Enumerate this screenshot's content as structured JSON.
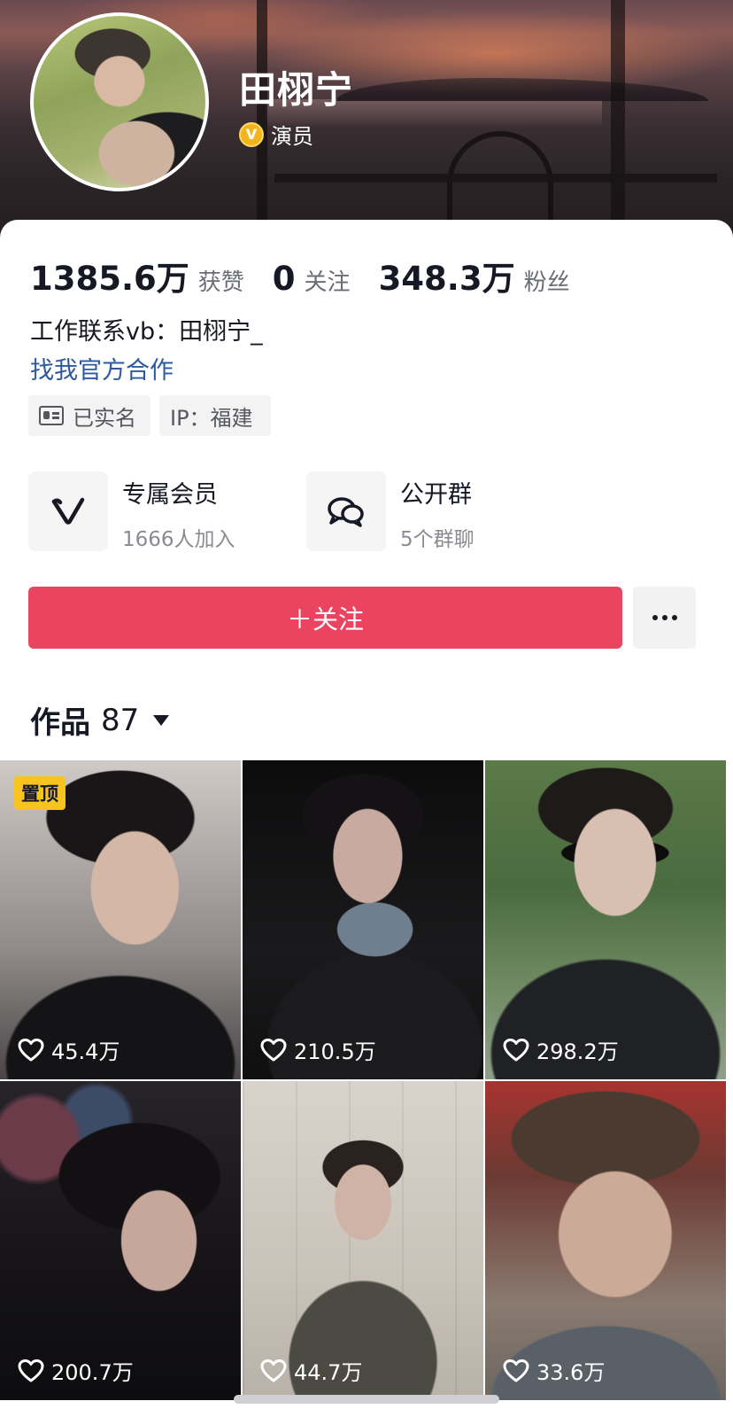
{
  "profile": {
    "name": "田栩宁",
    "verify_badge": "V",
    "verify_label": "演员",
    "stats": [
      {
        "num": "1385.6万",
        "label": "获赞"
      },
      {
        "num": "0",
        "label": "关注"
      },
      {
        "num": "348.3万",
        "label": "粉丝"
      }
    ],
    "bio": "工作联系vb：田栩宁_",
    "link": "找我官方合作",
    "tags": {
      "realname": "已实名",
      "ip": "IP：福建"
    }
  },
  "features": {
    "member": {
      "title": "专属会员",
      "sub": "1666人加入"
    },
    "group": {
      "title": "公开群",
      "sub": "5个群聊"
    }
  },
  "actions": {
    "follow_label": "＋关注"
  },
  "works": {
    "label": "作品",
    "count": "87"
  },
  "videos": [
    {
      "likes": "45.4万",
      "pinned": "置顶"
    },
    {
      "likes": "210.5万"
    },
    {
      "likes": "298.2万"
    },
    {
      "likes": "200.7万"
    },
    {
      "likes": "44.7万"
    },
    {
      "likes": "33.6万"
    }
  ],
  "colors": {
    "follow_button": "#ea4460",
    "pin_badge": "#f7c31d",
    "verify_badge": "#f3b51c",
    "link": "#2c5aa0"
  },
  "icons": {
    "verify": "verified-v-icon",
    "realname": "id-card-icon",
    "member": "vip-v-icon",
    "group": "chat-bubbles-icon",
    "more": "more-dots-icon",
    "works_caret": "caret-down-icon",
    "likes": "heart-outline-icon"
  }
}
